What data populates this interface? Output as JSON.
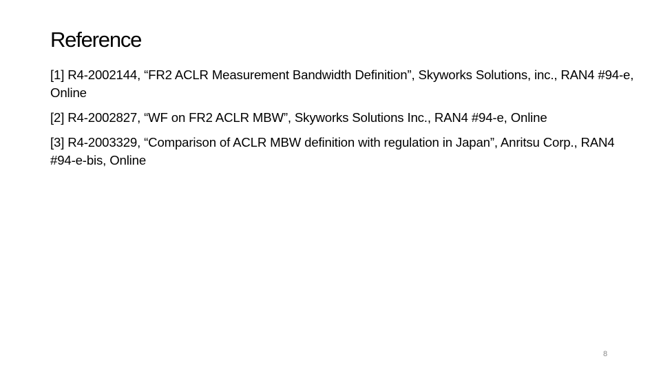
{
  "slide": {
    "title": "Reference",
    "references": [
      {
        "text": "[1] R4-2002144, “FR2 ACLR Measurement Bandwidth Definition”, Skyworks Solutions, inc., RAN4 #94-e, Online"
      },
      {
        "text": "[2] R4-2002827, “WF on FR2 ACLR MBW”, Skyworks Solutions Inc., RAN4 #94-e, Online"
      },
      {
        "text": "[3] R4-2003329, “Comparison of ACLR MBW definition with regulation in Japan”, Anritsu Corp., RAN4 #94-e-bis, Online"
      }
    ],
    "page_number": "8"
  }
}
